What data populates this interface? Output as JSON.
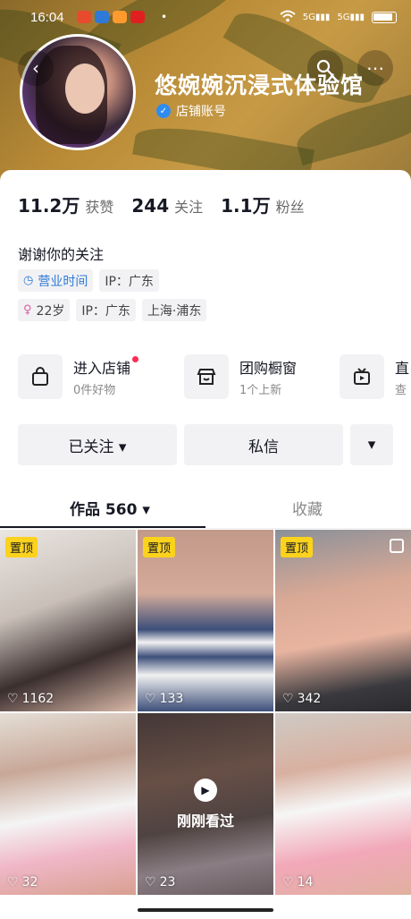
{
  "status_bar": {
    "time": "16:04",
    "dot": "•",
    "net1": "5G",
    "net2": "5G"
  },
  "header": {
    "back_icon": "back-arrow-icon",
    "search_icon": "search-icon",
    "more_icon": "more-icon",
    "name": "悠婉婉沉浸式体验馆",
    "verify_label": "店铺账号"
  },
  "stats": [
    {
      "num": "11.2万",
      "label": "获赞"
    },
    {
      "num": "244",
      "label": "关注"
    },
    {
      "num": "1.1万",
      "label": "粉丝"
    }
  ],
  "bio": "谢谢你的关注",
  "tags_row1": [
    {
      "icon": "◷",
      "text": "营业时间"
    },
    {
      "icon": "",
      "text": "IP：广东"
    }
  ],
  "tags_row2": [
    {
      "icon": "♀",
      "text": "22岁"
    },
    {
      "icon": "",
      "text": "IP：广东"
    },
    {
      "icon": "",
      "text": "上海·浦东"
    }
  ],
  "services": [
    {
      "title": "进入店铺",
      "sub": "0件好物"
    },
    {
      "title": "团购橱窗",
      "sub": "1个上新"
    },
    {
      "title": "直",
      "sub": "查"
    }
  ],
  "buttons": {
    "followed": "已关注 ▾",
    "message": "私信",
    "more": "▾"
  },
  "tabs": {
    "works": "作品 560 ▾",
    "favorites": "收藏"
  },
  "videos": [
    {
      "pinned": "置顶",
      "likes": "1162"
    },
    {
      "pinned": "置顶",
      "likes": "133"
    },
    {
      "pinned": "置顶",
      "likes": "342"
    },
    {
      "pinned": "",
      "likes": "32"
    },
    {
      "pinned": "",
      "likes": "23",
      "overlay": "刚刚看过"
    },
    {
      "pinned": "",
      "likes": "14"
    }
  ],
  "colors": {
    "accent": "#fe2c55",
    "pin": "#fbd21c",
    "verify": "#2e8cf0"
  }
}
